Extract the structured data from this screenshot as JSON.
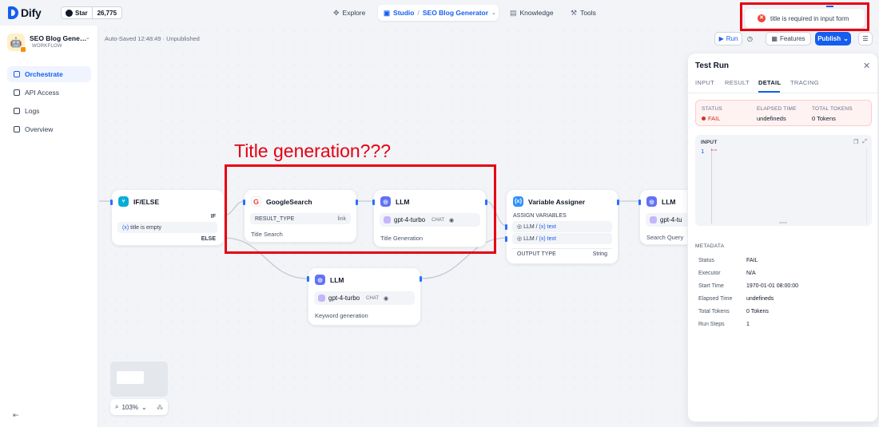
{
  "topbar": {
    "logo_text": "Dify",
    "github_star_label": "Star",
    "github_star_count": "26,775",
    "nav": {
      "explore": "Explore",
      "studio": "Studio",
      "app_selector": "SEO Blog Generator",
      "knowledge": "Knowledge",
      "tools": "Tools"
    }
  },
  "toast": {
    "message": "title is required in input form",
    "type": "error"
  },
  "sidebar": {
    "app_name": "SEO Blog Generator",
    "app_type": "WORKFLOW",
    "items": [
      {
        "label": "Orchestrate",
        "active": true
      },
      {
        "label": "API Access",
        "active": false
      },
      {
        "label": "Logs",
        "active": false
      },
      {
        "label": "Overview",
        "active": false
      }
    ]
  },
  "canvas": {
    "autosave": "Auto-Saved 12:48:49 · Unpublished",
    "toolbar": {
      "run": "Run",
      "features": "Features",
      "publish": "Publish"
    },
    "annotation": "Title generation???",
    "zoom": "103%",
    "nodes": {
      "ifelse": {
        "title": "IF/ELSE",
        "if": "IF",
        "condition_var": "(x)",
        "condition_text": "title is empty",
        "else": "ELSE"
      },
      "google": {
        "title": "GoogleSearch",
        "param_key": "RESULT_TYPE",
        "param_value": "link",
        "desc": "Title Search"
      },
      "llm_title": {
        "title": "LLM",
        "model": "gpt-4-turbo",
        "mode": "CHAT",
        "desc": "Title Generation"
      },
      "var_assigner": {
        "title": "Variable Assigner",
        "section": "ASSIGN VARIABLES",
        "vars": [
          {
            "node": "LLM",
            "var": "(x) text"
          },
          {
            "node": "LLM",
            "var": "(x) text"
          }
        ],
        "output_key": "OUTPUT TYPE",
        "output_value": "String"
      },
      "llm_search": {
        "title": "LLM",
        "model": "gpt-4-tu",
        "desc": "Search Query"
      },
      "llm_keyword": {
        "title": "LLM",
        "model": "gpt-4-turbo",
        "mode": "CHAT",
        "desc": "Keyword generation"
      }
    }
  },
  "test_run": {
    "title": "Test Run",
    "tabs": [
      "INPUT",
      "RESULT",
      "DETAIL",
      "TRACING"
    ],
    "active_tab": "DETAIL",
    "status": {
      "status_label": "STATUS",
      "status_value": "FAIL",
      "elapsed_label": "ELAPSED TIME",
      "elapsed_value": "undefineds",
      "tokens_label": "TOTAL TOKENS",
      "tokens_value": "0 Tokens"
    },
    "input": {
      "label": "INPUT",
      "line": "1",
      "code": "\"\""
    },
    "metadata": {
      "heading": "METADATA",
      "rows": [
        {
          "key": "Status",
          "value": "FAIL"
        },
        {
          "key": "Executor",
          "value": "N/A"
        },
        {
          "key": "Start Time",
          "value": "1970-01-01 08:00:00"
        },
        {
          "key": "Elapsed Time",
          "value": "undefineds"
        },
        {
          "key": "Total Tokens",
          "value": "0 Tokens"
        },
        {
          "key": "Run Steps",
          "value": "1"
        }
      ]
    }
  },
  "colors": {
    "primary": "#155eef",
    "error": "#d92d20",
    "annotation": "#e60012"
  }
}
